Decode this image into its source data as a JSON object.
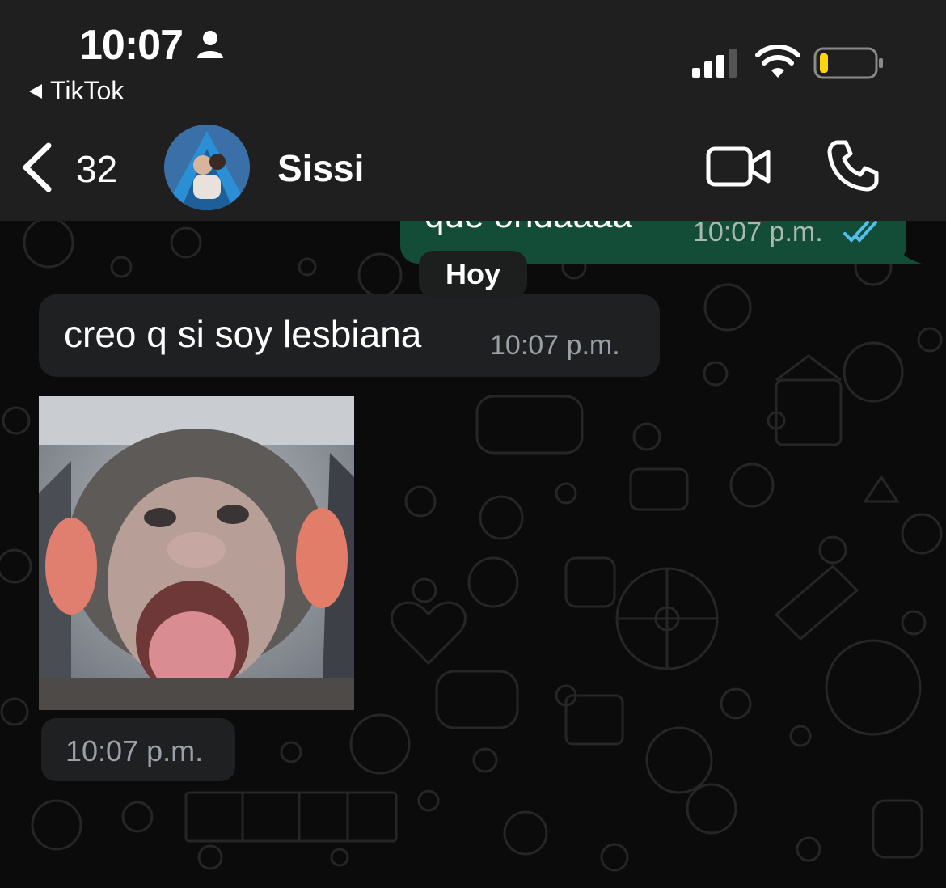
{
  "status_bar": {
    "time": "10:07",
    "back_app_label": "TikTok",
    "battery_level": 0.1
  },
  "chat_header": {
    "unread_count": "32",
    "contact_name": "Sissi"
  },
  "messages": {
    "outgoing": {
      "text": "que ondaaaa",
      "time": "10:07 p.m.",
      "read": true
    },
    "date_separator": "Hoy",
    "incoming_text": {
      "text": "creo q si soy lesbiana",
      "time": "10:07 p.m."
    },
    "incoming_media": {
      "time": "10:07 p.m."
    }
  },
  "colors": {
    "header_bg": "#1f1f1f",
    "chat_bg": "#0b0b0b",
    "outgoing_bubble": "#144d37",
    "incoming_bubble": "#1e2022",
    "read_ticks": "#53bdeb",
    "battery_low": "#ffd60a"
  }
}
